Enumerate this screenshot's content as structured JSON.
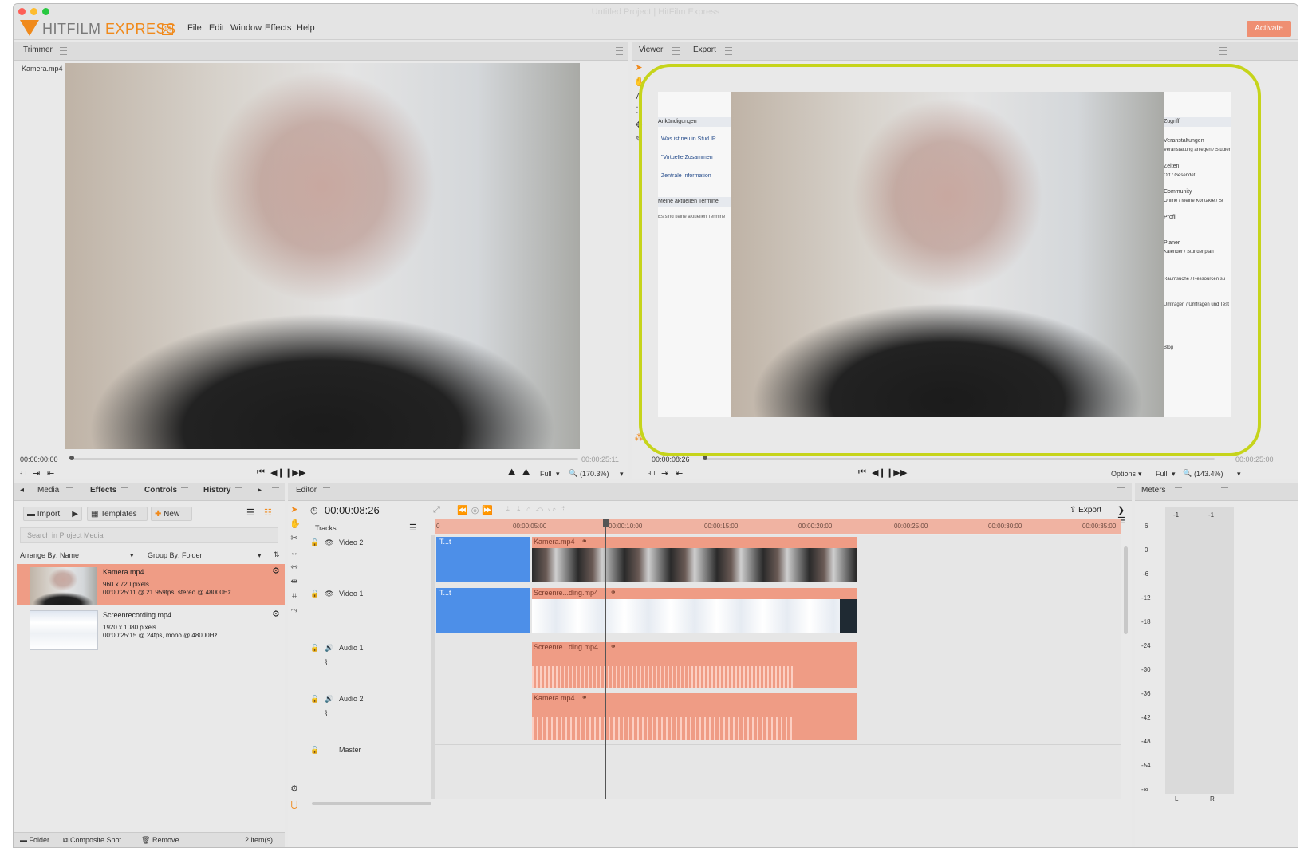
{
  "window": {
    "title": "Untitled Project | HitFilm Express"
  },
  "brand": {
    "name": "HITFILM",
    "suffix": "EXPRESS",
    "version": "14"
  },
  "menu": [
    "File",
    "Edit",
    "Window",
    "Effects",
    "Help"
  ],
  "activate_label": "Activate",
  "trimmer": {
    "tab": "Trimmer",
    "file": "Kamera.mp4",
    "timecode_start": "00:00:00:00",
    "timecode_end": "00:00:25:11",
    "quality": "Full",
    "zoom": "(170.3%)"
  },
  "viewer": {
    "tabs": [
      "Viewer",
      "Export"
    ],
    "timecode_start": "00:00:08:26",
    "timecode_end": "00:00:25:00",
    "options_label": "Options",
    "quality": "Full",
    "zoom": "(143.4%)",
    "left_panel_lines": [
      "Ankündigungen",
      "Was ist neu in Stud.IP",
      "\"Virtuelle Zusammen",
      "Zentrale Information",
      "Meine aktuellen Termine",
      "Es sind keine aktuellen Termine"
    ],
    "right_panel_lines": [
      "Zugriff",
      "Veranstaltungen",
      "Veranstaltung anlegen / Studien",
      "Zeiten",
      "Ort / Gesendet",
      "Community",
      "Online / Meine Kontakte / St",
      "Profil",
      "Planer",
      "Kalender / Stundenplan",
      "Raumsuche / Ressourcen su",
      "Umfragen / Umfragen und Test",
      "Blog"
    ]
  },
  "media_panel": {
    "tabs": [
      "Media",
      "Effects",
      "Controls",
      "History"
    ],
    "import_label": "Import",
    "templates_label": "Templates",
    "new_label": "New",
    "search_placeholder": "Search in Project Media",
    "arrange_by": "Arrange By: Name",
    "group_by": "Group By: Folder",
    "items": [
      {
        "name": "Kamera.mp4",
        "res": "960 x 720 pixels",
        "info": "00:00:25:11 @ 21.959fps, stereo @ 48000Hz",
        "selected": true
      },
      {
        "name": "Screenrecording.mp4",
        "res": "1920 x 1080 pixels",
        "info": "00:00:25:15 @ 24fps, mono @ 48000Hz",
        "selected": false
      }
    ],
    "footer": {
      "folder": "Folder",
      "composite": "Composite Shot",
      "remove": "Remove",
      "count": "2 item(s)"
    }
  },
  "editor": {
    "tab": "Editor",
    "timecode": "00:00:08:26",
    "export_label": "Export",
    "tracks_label": "Tracks",
    "ruler": [
      "0",
      "00:00:05:00",
      "00:00:10:00",
      "00:00:15:00",
      "00:00:20:00",
      "00:00:25:00",
      "00:00:30:00",
      "00:00:35:00"
    ],
    "tracks": [
      "Video 2",
      "Video 1",
      "Audio 1",
      "Audio 2",
      "Master"
    ],
    "clips": {
      "video2_text": "T...t",
      "video2_clip": "Kamera.mp4",
      "video1_text": "T...t",
      "video1_clip": "Screenre...ding.mp4",
      "audio1_clip": "Screenre...ding.mp4",
      "audio2_clip": "Kamera.mp4"
    }
  },
  "meters": {
    "tab": "Meters",
    "top": [
      "-1",
      "-1"
    ],
    "scale": [
      "6",
      "0",
      "-6",
      "-12",
      "-18",
      "-24",
      "-30",
      "-36",
      "-42",
      "-48",
      "-54",
      "-∞"
    ],
    "channels": [
      "L",
      "R"
    ]
  },
  "colors": {
    "accent": "#f08a1c",
    "clip": "#ef9c85",
    "title_clip": "#4d8fe8",
    "highlight": "#c6d41b",
    "activate": "#ef8f72"
  }
}
